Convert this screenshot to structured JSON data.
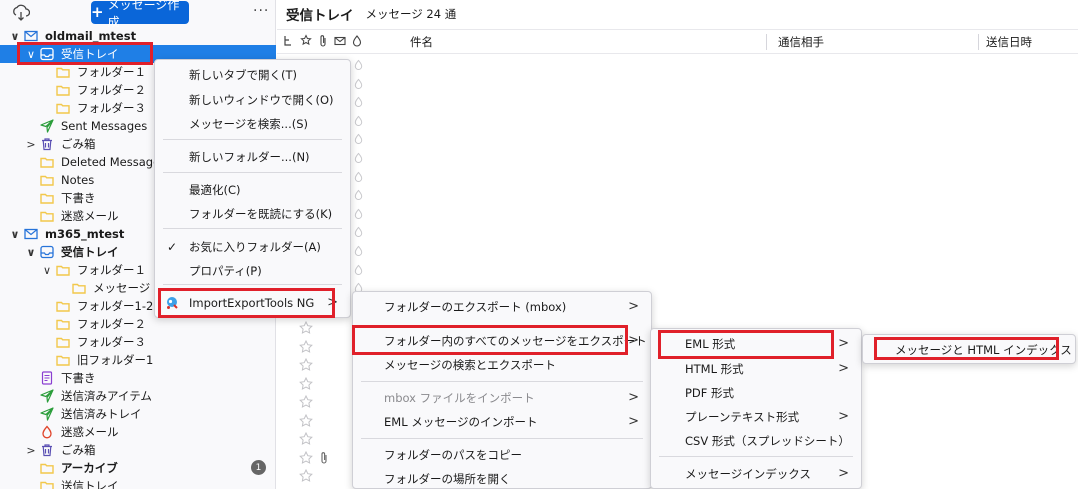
{
  "folder_pane": {
    "new_message_label": "メッセージ作成",
    "more_label": "···",
    "unread_badge": "1",
    "folders": [
      {
        "label": "oldmail_mtest",
        "icon": "mail-account-icon",
        "bold": true,
        "twisty": "∨",
        "level": 0
      },
      {
        "label": "受信トレイ",
        "icon": "inbox-icon",
        "selected": true,
        "twisty": "∨",
        "level": 1
      },
      {
        "label": "フォルダー１",
        "icon": "folder-icon",
        "level": 2
      },
      {
        "label": "フォルダー２",
        "icon": "folder-icon",
        "level": 2
      },
      {
        "label": "フォルダー３",
        "icon": "folder-icon",
        "level": 2
      },
      {
        "label": "Sent Messages",
        "icon": "sent-icon",
        "level": 1
      },
      {
        "label": "ごみ箱",
        "icon": "trash-icon",
        "twisty": ">",
        "level": 1
      },
      {
        "label": "Deleted Messages",
        "icon": "folder-icon",
        "level": 1
      },
      {
        "label": "Notes",
        "icon": "folder-icon",
        "level": 1
      },
      {
        "label": "下書き",
        "icon": "folder-icon",
        "level": 1
      },
      {
        "label": "迷惑メール",
        "icon": "folder-icon",
        "level": 1
      },
      {
        "label": "m365_mtest",
        "icon": "mail-account-icon",
        "bold": true,
        "twisty": "∨",
        "level": 0
      },
      {
        "label": "受信トレイ",
        "icon": "inbox-icon",
        "bold": true,
        "twisty": "∨",
        "level": 1
      },
      {
        "label": "フォルダー１",
        "icon": "folder-icon",
        "twisty": "∨",
        "level": 2
      },
      {
        "label": "メッセージ",
        "icon": "folder-icon",
        "level": 3
      },
      {
        "label": "フォルダー1-2",
        "icon": "folder-icon",
        "level": 2
      },
      {
        "label": "フォルダー２",
        "icon": "folder-icon",
        "level": 2
      },
      {
        "label": "フォルダー３",
        "icon": "folder-icon",
        "level": 2
      },
      {
        "label": "旧フォルダー1",
        "icon": "folder-icon",
        "level": 2
      },
      {
        "label": "下書き",
        "icon": "drafts-icon",
        "level": 1
      },
      {
        "label": "送信済みアイテム",
        "icon": "sent-icon",
        "level": 1
      },
      {
        "label": "送信済みトレイ",
        "icon": "sent-icon",
        "level": 1
      },
      {
        "label": "迷惑メール",
        "icon": "junk-icon",
        "level": 1
      },
      {
        "label": "ごみ箱",
        "icon": "trash-icon",
        "twisty": ">",
        "level": 1
      },
      {
        "label": "アーカイブ",
        "icon": "folder-icon",
        "bold": true,
        "level": 1
      },
      {
        "label": "送信トレイ",
        "icon": "folder-icon",
        "level": 1
      }
    ]
  },
  "message_pane": {
    "title": "受信トレイ",
    "count": "メッセージ 24 通",
    "columns": {
      "subject": "件名",
      "correspondent": "通信相手",
      "date": "送信日時"
    }
  },
  "context_menu": {
    "items": [
      {
        "label": "新しいタブで開く(T)"
      },
      {
        "label": "新しいウィンドウで開く(O)"
      },
      {
        "label": "メッセージを検索...(S)"
      },
      {
        "label": "新しいフォルダー...(N)"
      },
      {
        "label": "最適化(C)"
      },
      {
        "label": "フォルダーを既読にする(K)"
      },
      {
        "label": "お気に入りフォルダー(A)",
        "check": "✓"
      },
      {
        "label": "プロパティ(P)"
      },
      {
        "label": "ImportExportTools NG",
        "arrow": ">"
      }
    ]
  },
  "submenu1": {
    "items": [
      {
        "label": "フォルダーのエクスポート (mbox)",
        "arrow": ">"
      },
      {
        "label": "フォルダー内のすべてのメッセージをエクスポート",
        "arrow": ">"
      },
      {
        "label": "メッセージの検索とエクスポート"
      },
      {
        "label": "mbox ファイルをインポート",
        "arrow": ">",
        "disabled": true
      },
      {
        "label": "EML メッセージのインポート",
        "arrow": ">"
      },
      {
        "label": "フォルダーのパスをコピー"
      },
      {
        "label": "フォルダーの場所を開く"
      }
    ]
  },
  "submenu2": {
    "items": [
      {
        "label": "EML 形式",
        "arrow": ">"
      },
      {
        "label": "HTML 形式",
        "arrow": ">"
      },
      {
        "label": "PDF 形式"
      },
      {
        "label": "プレーンテキスト形式",
        "arrow": ">"
      },
      {
        "label": "CSV 形式（スプレッドシート）"
      },
      {
        "label": "メッセージインデックス",
        "arrow": ">"
      }
    ]
  },
  "submenu3": {
    "items": [
      {
        "label": "メッセージと HTML インデックス"
      }
    ]
  },
  "colors": {
    "accent": "#0a66d9",
    "selection": "#1f7fe6",
    "highlight_box": "#e0202a",
    "folder": "#f2c84b",
    "sent": "#2a9d3a",
    "trash": "#5a4fb3"
  }
}
